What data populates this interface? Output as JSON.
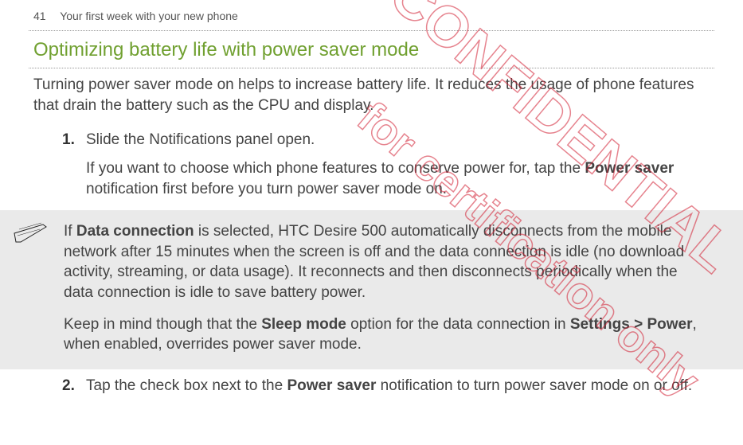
{
  "header": {
    "page_number": "41",
    "section_name": "Your first week with your new phone"
  },
  "title": "Optimizing battery life with power saver mode",
  "lead": "Turning power saver mode on helps to increase battery life. It reduces the usage of phone features that drain the battery such as the CPU and display.",
  "steps": [
    {
      "text": "Slide the Notifications panel open.",
      "subtext_before": "If you want to choose which phone features to conserve power for, tap the ",
      "subtext_bold": "Power saver",
      "subtext_after": " notification first before you turn power saver mode on."
    },
    {
      "text_before": "Tap the check box next to the ",
      "text_bold": "Power saver",
      "text_after": " notification to turn power saver mode on or off."
    }
  ],
  "note": {
    "p1_before": "If ",
    "p1_bold1": "Data connection",
    "p1_after": " is selected, HTC Desire 500 automatically disconnects from the mobile network after 15 minutes when the screen is off and the data connection is idle (no download activity, streaming, or data usage). It reconnects and then disconnects periodically when the data connection is idle to save battery power.",
    "p2_before": "Keep in mind though that the ",
    "p2_bold1": "Sleep mode",
    "p2_mid": " option for the data connection in ",
    "p2_bold2": "Settings > Power",
    "p2_after": ", when enabled, overrides power saver mode."
  },
  "watermarks": {
    "w1": "HTC CONFIDENTIAL",
    "w2": "for certification only"
  }
}
